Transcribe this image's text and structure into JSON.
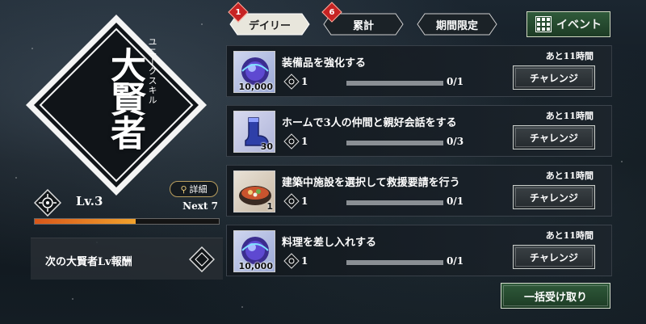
{
  "skill": {
    "name": "大賢者",
    "subtitle": "ユニークスキル"
  },
  "level": {
    "label": "Lv.3",
    "next": "Next 7",
    "progress": 0.55,
    "detail_label": "詳細"
  },
  "reward_panel": {
    "label": "次の大賢者Lv報酬"
  },
  "tabs": [
    {
      "label": "デイリー",
      "badge": "1",
      "active": true
    },
    {
      "label": "累計",
      "badge": "6",
      "active": false
    },
    {
      "label": "期間限定",
      "badge": "",
      "active": false
    }
  ],
  "event_button": {
    "label": "イベント"
  },
  "missions": [
    {
      "title": "装備品を強化する",
      "thumb": "magic-orb-icon",
      "qty": "10,000",
      "reward": "1",
      "progress": "0/1",
      "time": "あと11時間",
      "button": "チャレンジ"
    },
    {
      "title": "ホームで3人の仲間と親好会話をする",
      "thumb": "blue-boot-icon",
      "qty": "30",
      "reward": "1",
      "progress": "0/3",
      "time": "あと11時間",
      "button": "チャレンジ"
    },
    {
      "title": "建築中施設を選択して救援要請を行う",
      "thumb": "hot-pot-icon",
      "qty": "1",
      "reward": "1",
      "progress": "0/1",
      "time": "あと11時間",
      "button": "チャレンジ"
    },
    {
      "title": "料理を差し入れする",
      "thumb": "magic-orb-icon",
      "qty": "10,000",
      "reward": "1",
      "progress": "0/1",
      "time": "あと11時間",
      "button": "チャレンジ"
    }
  ],
  "claim_all": {
    "label": "一括受け取り"
  },
  "colors": {
    "accent_green": "#2f5a3a",
    "badge_red": "#c62323",
    "xp_orange": "#f2a22c"
  }
}
